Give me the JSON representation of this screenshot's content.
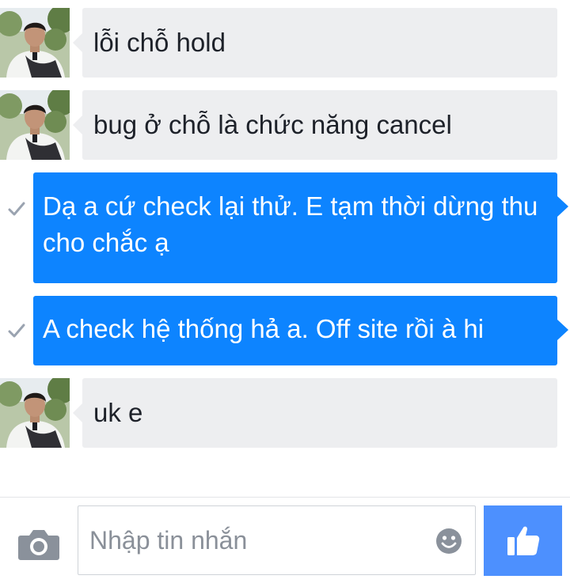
{
  "thread": {
    "messages": [
      {
        "direction": "incoming",
        "text": "lỗi chỗ hold",
        "avatar_icon": "user-avatar"
      },
      {
        "direction": "incoming",
        "text": "bug ở chỗ là chức năng cancel",
        "avatar_icon": "user-avatar"
      },
      {
        "direction": "outgoing",
        "lines": [
          "Dạ a cứ check lại thử. E tạm thời dừng thu",
          "cho chắc ạ"
        ],
        "status_icon": "check-icon"
      },
      {
        "direction": "outgoing",
        "text": "A check hệ thống hả a. Off site rồi à hi",
        "status_icon": "check-icon"
      },
      {
        "direction": "incoming",
        "text": "uk e",
        "avatar_icon": "user-avatar"
      }
    ]
  },
  "composer": {
    "placeholder": "Nhập tin nhắn",
    "value": "",
    "camera_icon": "camera-icon",
    "emoji_icon": "smiley-icon",
    "send_icon": "thumbs-up-icon"
  },
  "colors": {
    "incoming_bubble": "#edeef0",
    "outgoing_bubble": "#0d84ff",
    "like_button": "#4d90fe",
    "check": "#9aa3b0"
  }
}
